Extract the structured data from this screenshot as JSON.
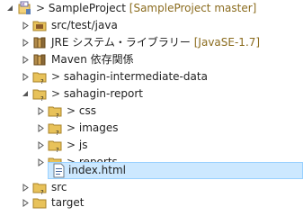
{
  "tree": {
    "project": {
      "prefix": ">",
      "label": "SampleProject",
      "decoration": "[SampleProject master]"
    },
    "src_test_java": {
      "label": "src/test/java"
    },
    "jre": {
      "label": "JRE システム・ライブラリー",
      "decoration": "[JavaSE-1.7]"
    },
    "maven": {
      "label": "Maven 依存関係"
    },
    "intermediate": {
      "prefix": ">",
      "label": "sahagin-intermediate-data"
    },
    "report": {
      "prefix": ">",
      "label": "sahagin-report"
    },
    "css": {
      "prefix": ">",
      "label": "css"
    },
    "images": {
      "prefix": ">",
      "label": "images"
    },
    "js": {
      "prefix": ">",
      "label": "js"
    },
    "reports": {
      "prefix": ">",
      "label": "reports"
    },
    "index": {
      "label": "index.html"
    },
    "src": {
      "label": "src"
    },
    "target": {
      "label": "target"
    }
  },
  "colors": {
    "selection_bg": "#cce8ff",
    "selection_border": "#99d1ff",
    "decoration_text": "#8b6c1f",
    "folder": "#e8c25a"
  }
}
